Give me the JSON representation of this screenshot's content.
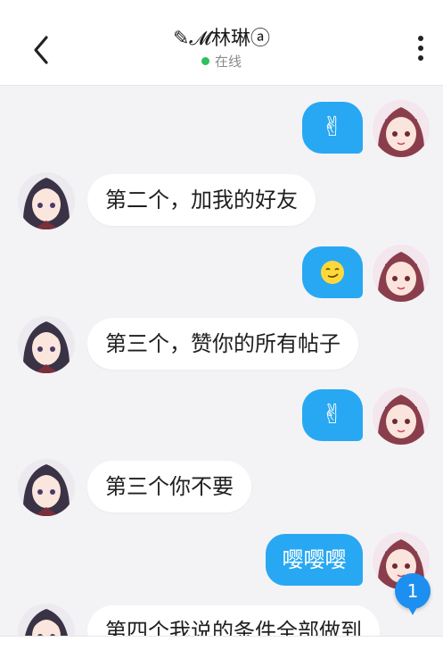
{
  "header": {
    "title": "✎𝓜林琳ⓐ",
    "status": "在线"
  },
  "messages": [
    {
      "side": "right",
      "kind": "emoji",
      "icon": "victory-hand-emoji",
      "content": "✌"
    },
    {
      "side": "left",
      "kind": "text",
      "content": "第二个，加我的好友"
    },
    {
      "side": "right",
      "kind": "emoji",
      "icon": "smirk-emoji",
      "content": ""
    },
    {
      "side": "left",
      "kind": "text",
      "content": "第三个，赞你的所有帖子"
    },
    {
      "side": "right",
      "kind": "emoji",
      "icon": "victory-hand-emoji",
      "content": "✌"
    },
    {
      "side": "left",
      "kind": "text",
      "content": "第三个你不要"
    },
    {
      "side": "right",
      "kind": "text",
      "content": "嘤嘤嘤"
    },
    {
      "side": "left",
      "kind": "text",
      "content": "第四个我说的条件全部做到"
    }
  ],
  "new_message_badge": "1",
  "colors": {
    "accent": "#28a8f2",
    "badge": "#1d8ff0",
    "online": "#2ec05a"
  }
}
